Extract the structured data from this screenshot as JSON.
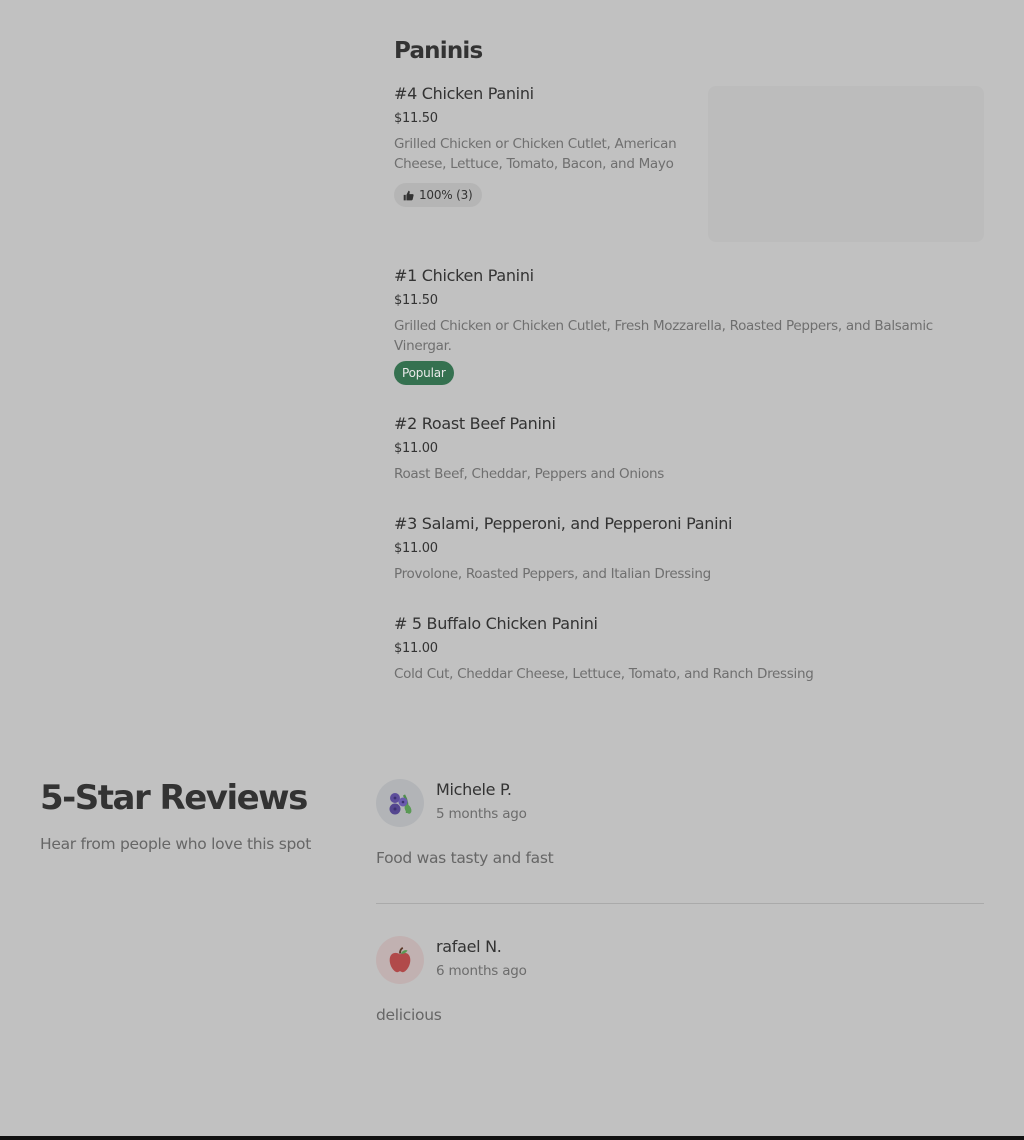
{
  "section_title": "Paninis",
  "items": [
    {
      "name": "#4 Chicken Panini",
      "price": "$11.50",
      "description": "Grilled Chicken or Chicken Cutlet, American Cheese, Lettuce, Tomato, Bacon, and Mayo",
      "rating": "100% (3)"
    },
    {
      "name": "#1 Chicken Panini",
      "price": "$11.50",
      "description": "Grilled Chicken or Chicken Cutlet, Fresh Mozzarella, Roasted Peppers, and Balsamic Vinergar.",
      "badge": "Popular"
    },
    {
      "name": "#2 Roast Beef Panini",
      "price": "$11.00",
      "description": "Roast Beef, Cheddar, Peppers and Onions"
    },
    {
      "name": "#3 Salami, Pepperoni, and Pepperoni Panini",
      "price": "$11.00",
      "description": "Provolone, Roasted Peppers, and Italian Dressing"
    },
    {
      "name": "# 5 Buffalo Chicken Panini",
      "price": "$11.00",
      "description": "Cold Cut, Cheddar Cheese, Lettuce, Tomato, and Ranch Dressing"
    }
  ],
  "reviews_section": {
    "title": "5-Star Reviews",
    "subtitle": "Hear from people who love this spot"
  },
  "reviews": [
    {
      "name": "Michele P.",
      "date": "5 months ago",
      "text": "Food was tasty and fast",
      "avatar_icon": "blueberries-icon",
      "avatar_bg": "#b2b4b7"
    },
    {
      "name": "rafael N.",
      "date": "6 months ago",
      "text": "delicious",
      "avatar_icon": "apple-icon",
      "avatar_bg": "#c1b1b1"
    }
  ],
  "colors": {
    "background": "#c1c1c1",
    "popular_badge": "#357150",
    "rating_badge": "#b5b5b5",
    "text_primary": "#333333",
    "text_secondary": "#6f6f6f"
  }
}
